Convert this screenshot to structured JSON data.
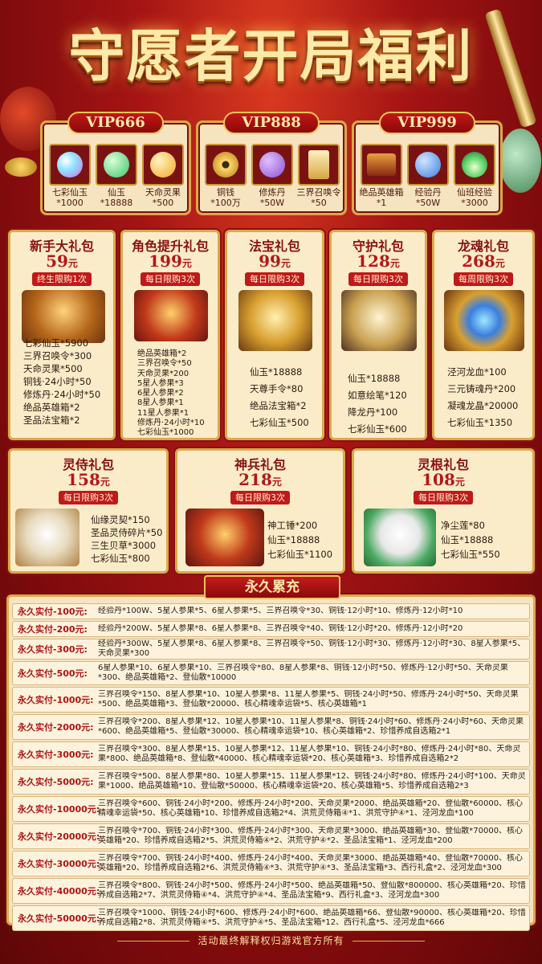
{
  "title": "守愿者开局福利",
  "vip": [
    {
      "label": "VIP666",
      "items": [
        {
          "name": "七彩仙玉",
          "count": "*1000",
          "color": "#8fe3ff"
        },
        {
          "name": "仙玉",
          "count": "*18888",
          "color": "#3cc36a"
        },
        {
          "name": "天命灵果",
          "count": "*500",
          "color": "#f5a623"
        }
      ]
    },
    {
      "label": "VIP888",
      "items": [
        {
          "name": "铜钱",
          "count": "*100万",
          "color": "#d9a441"
        },
        {
          "name": "修炼丹",
          "count": "*50W",
          "color": "#8c4fd1"
        },
        {
          "name": "三界召唤令",
          "count": "*50",
          "color": "#e8c46a"
        }
      ]
    },
    {
      "label": "VIP999",
      "items": [
        {
          "name": "绝品英雄箱",
          "count": "*1",
          "color": "#c23b18"
        },
        {
          "name": "经验丹",
          "count": "*50W",
          "color": "#3b7fe0"
        },
        {
          "name": "仙班经验",
          "count": "*3000",
          "color": "#5fd36a"
        }
      ]
    }
  ],
  "packs": [
    {
      "title": "新手大礼包",
      "price": "59",
      "unit": "元",
      "limit": "终生限购1次",
      "items": [
        "七彩仙玉*5900",
        "三界召唤令*300",
        "天命灵果*500",
        "铜钱·24小时*50",
        "修炼丹·24小时*50",
        "绝品英雄箱*2",
        "圣品法宝箱*2"
      ]
    },
    {
      "title": "角色提升礼包",
      "price": "199",
      "unit": "元",
      "limit": "每日限购3次",
      "items": [
        "绝品英雄箱*2",
        "三界召唤令*50",
        "天命灵果*200",
        "5星人参果*3",
        "6星人参果*2",
        "8星人参果*1",
        "11星人参果*1",
        "修炼丹·24小时*10",
        "七彩仙玉*1000"
      ]
    },
    {
      "title": "法宝礼包",
      "price": "99",
      "unit": "元",
      "limit": "每日限购3次",
      "items": [
        "仙玉*18888",
        "天尊手令*80",
        "绝品法宝箱*2",
        "七彩仙玉*500"
      ]
    },
    {
      "title": "守护礼包",
      "price": "128",
      "unit": "元",
      "limit": "每日限购3次",
      "items": [
        "仙玉*18888",
        "如意绘笔*120",
        "降龙丹*100",
        "七彩仙玉*600"
      ]
    },
    {
      "title": "龙魂礼包",
      "price": "268",
      "unit": "元",
      "limit": "每周限购3次",
      "items": [
        "泾河龙血*100",
        "三元铸魂丹*200",
        "凝魂龙晶*20000",
        "七彩仙玉*1350"
      ]
    },
    {
      "title": "灵侍礼包",
      "price": "158",
      "unit": "元",
      "limit": "每日限购3次",
      "items": [
        "仙缘灵契*150",
        "圣品灵侍碎片*50",
        "三生贝草*3000",
        "七彩仙玉*800"
      ]
    },
    {
      "title": "神兵礼包",
      "price": "218",
      "unit": "元",
      "limit": "每日限购3次",
      "items": [
        "神工锤*200",
        "仙玉*18888",
        "七彩仙玉*1100"
      ]
    },
    {
      "title": "灵根礼包",
      "price": "108",
      "unit": "元",
      "limit": "每日限购3次",
      "items": [
        "净尘莲*80",
        "仙玉*18888",
        "七彩仙玉*550"
      ]
    }
  ],
  "permanent": {
    "title": "永久累充",
    "rows": [
      {
        "label": "永久实付-100元:",
        "text": "经验丹*100W、5星人参果*5、6星人参果*5、三界召唤令*30、铜钱·12小时*10、修炼丹·12小时*10"
      },
      {
        "label": "永久实付-200元:",
        "text": "经验丹*200W、5星人参果*8、6星人参果*8、三界召唤令*40、铜钱·12小时*20、修炼丹·12小时*20"
      },
      {
        "label": "永久实付-300元:",
        "text": "经验丹*300W、5星人参果*8、6星人参果*8、三界召唤令*50、铜钱·12小时*30、修炼丹·12小时*30、8星人参果*5、天命灵果*300"
      },
      {
        "label": "永久实付-500元:",
        "text": "6星人参果*10、6星人参果*10、三界召唤令*80、8星人参果*8、铜钱·12小时*50、修炼丹·12小时*50、天命灵果*300、绝品英雄箱*2、登仙散*10000"
      },
      {
        "label": "永久实付-1000元:",
        "text": "三界召唤令*150、8星人参果*10、10星人参果*8、11星人参果*5、铜钱·24小时*50、修炼丹·24小时*50、天命灵果*500、绝品英雄箱*3、登仙散*20000、核心精魂幸运袋*5、核心英雄箱*1"
      },
      {
        "label": "永久实付-2000元:",
        "text": "三界召唤令*200、8星人参果*12、10星人参果*10、11星人参果*8、铜钱·24小时*60、修炼丹·24小时*60、天命灵果*600、绝品英雄箱*5、登仙散*30000、核心精魂幸运袋*10、核心英雄箱*2、珍惜养成自选箱2*1"
      },
      {
        "label": "永久实付-3000元:",
        "text": "三界召唤令*300、8星人参果*15、10星人参果*12、11星人参果*10、铜钱·24小时*80、修炼丹·24小时*80、天命灵果*800、绝品英雄箱*8、登仙散*40000、核心精魂幸运袋*20、核心英雄箱*3、珍惜养成自选箱2*2"
      },
      {
        "label": "永久实付-5000元:",
        "text": "三界召唤令*500、8星人参果*80、10星人参果*15、11星人参果*12、铜钱·24小时*80、修炼丹·24小时*100、天命灵果*1000、绝品英雄箱*10、登仙散*50000、核心精魂幸运袋*20、核心英雄箱*5、珍惜养成自选箱2*3"
      },
      {
        "label": "永久实付-10000元:",
        "text": "三界召唤令*600、铜钱·24小时*200、修炼丹·24小时*200、天命灵果*2000、绝品英雄箱*20、登仙散*60000、核心精魂幸运袋*50、核心英雄箱*10、珍惜养成自选箱2*4、洪荒灵侍箱④*1、洪荒守护④*1、泾河龙血*100"
      },
      {
        "label": "永久实付-20000元:",
        "text": "三界召唤令*700、铜钱·24小时*300、修炼丹·24小时*300、天命灵果*3000、绝品英雄箱*30、登仙散*70000、核心英雄箱*20、珍惜养成自选箱2*5、洪荒灵侍箱④*2、洪荒守护④*2、圣品法宝箱*1、泾河龙血*200"
      },
      {
        "label": "永久实付-30000元:",
        "text": "三界召唤令*700、铜钱·24小时*400、修炼丹·24小时*400、天命灵果*3000、绝品英雄箱*40、登仙散*70000、核心英雄箱*20、珍惜养成自选箱2*6、洪荒灵侍箱④*3、洪荒守护④*3、圣品法宝箱*3、西行礼盒*2、泾河龙血*300"
      },
      {
        "label": "永久实付-40000元:",
        "text": "三界召唤令*800、铜钱·24小时*500、修炼丹·24小时*500、绝品英雄箱*50、登仙散*800000、核心英雄箱*20、珍惜养成自选箱2*7、洪荒灵侍箱④*4、洪荒守护④*4、圣品法宝箱*9、西行礼盒*3、泾河龙血*300"
      },
      {
        "label": "永久实付-50000元:",
        "text": "三界召唤令*1000、铜钱·24小时*600、修炼丹·24小时*600、绝品英雄箱*66、登仙散*90000、核心英雄箱*20、珍惜养成自选箱2*8、洪荒灵侍箱④*5、洪荒守护④*5、圣品法宝箱*12、西行礼盒*5、泾河龙血*666"
      }
    ]
  },
  "footer": "活动最终解释权归游戏官方所有"
}
